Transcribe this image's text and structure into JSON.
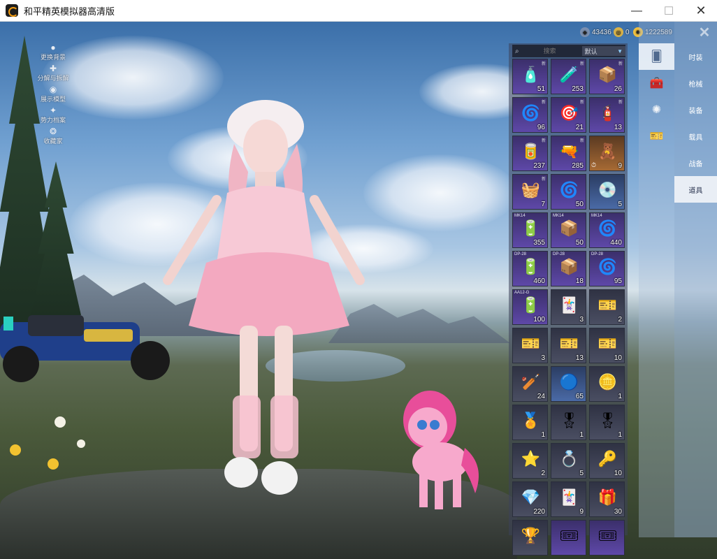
{
  "window": {
    "title": "和平精英模拟器高清版",
    "minimize": "—",
    "maximize": "☐",
    "close": "✕"
  },
  "quick_menu": [
    {
      "label": "更换背景",
      "icon": "person-icon"
    },
    {
      "label": "分解与拆解",
      "icon": "puzzle-icon"
    },
    {
      "label": "展示模型",
      "icon": "eye-icon"
    },
    {
      "label": "势力档案",
      "icon": "emblem-icon"
    },
    {
      "label": "收藏家",
      "icon": "badge-icon"
    }
  ],
  "currency": [
    {
      "value": "43436",
      "icon": "coin-icon",
      "color": "#7a8fb0"
    },
    {
      "value": "0",
      "icon": "token-icon",
      "color": "#d8b34a"
    },
    {
      "value": "1222589",
      "icon": "gold-icon",
      "color": "#f0c040"
    }
  ],
  "inventory": {
    "search_placeholder": "搜索",
    "sort_label": "默认",
    "items": [
      {
        "count": "51",
        "style": "purple",
        "glyph": "🧴",
        "new": "新"
      },
      {
        "count": "253",
        "style": "purple",
        "glyph": "🧪",
        "new": "新"
      },
      {
        "count": "26",
        "style": "purple",
        "glyph": "📦",
        "new": "新"
      },
      {
        "count": "96",
        "style": "purple",
        "glyph": "🌀",
        "new": "新"
      },
      {
        "count": "21",
        "style": "purple",
        "glyph": "🎯",
        "new": "新"
      },
      {
        "count": "13",
        "style": "purple",
        "glyph": "🧯",
        "new": "新"
      },
      {
        "count": "237",
        "style": "purple",
        "glyph": "🥫",
        "new": "新"
      },
      {
        "count": "285",
        "style": "purple",
        "glyph": "🔫",
        "new": "新"
      },
      {
        "count": "9",
        "style": "orange",
        "glyph": "🧸",
        "new": "",
        "timer": "⏱"
      },
      {
        "count": "7",
        "style": "purple",
        "glyph": "🧺",
        "new": "新"
      },
      {
        "count": "50",
        "style": "purple",
        "glyph": "🌀",
        "new": ""
      },
      {
        "count": "5",
        "style": "blue",
        "glyph": "💿",
        "new": ""
      },
      {
        "count": "355",
        "style": "purple",
        "glyph": "🔋",
        "tag": "MK14"
      },
      {
        "count": "50",
        "style": "purple",
        "glyph": "📦",
        "tag": "MK14"
      },
      {
        "count": "440",
        "style": "purple",
        "glyph": "🌀",
        "tag": "MK14"
      },
      {
        "count": "460",
        "style": "purple",
        "glyph": "🔋",
        "tag": "DP-28"
      },
      {
        "count": "18",
        "style": "purple",
        "glyph": "📦",
        "tag": "DP-28"
      },
      {
        "count": "95",
        "style": "purple",
        "glyph": "🌀",
        "tag": "DP-28"
      },
      {
        "count": "100",
        "style": "purple",
        "glyph": "🔋",
        "tag": "AA12-G"
      },
      {
        "count": "3",
        "style": "dark",
        "glyph": "🃏",
        "new": ""
      },
      {
        "count": "2",
        "style": "dark",
        "glyph": "🎫",
        "new": ""
      },
      {
        "count": "3",
        "style": "dark",
        "glyph": "🎫",
        "new": ""
      },
      {
        "count": "13",
        "style": "dark",
        "glyph": "🎫",
        "new": ""
      },
      {
        "count": "10",
        "style": "dark",
        "glyph": "🎫",
        "new": ""
      },
      {
        "count": "24",
        "style": "dark",
        "glyph": "🏏",
        "new": ""
      },
      {
        "count": "65",
        "style": "blue",
        "glyph": "🔵",
        "new": ""
      },
      {
        "count": "1",
        "style": "dark",
        "glyph": "🪙",
        "new": ""
      },
      {
        "count": "1",
        "style": "dark",
        "glyph": "🏅",
        "new": ""
      },
      {
        "count": "1",
        "style": "dark",
        "glyph": "🎖",
        "new": ""
      },
      {
        "count": "1",
        "style": "dark",
        "glyph": "🎖",
        "new": ""
      },
      {
        "count": "2",
        "style": "dark",
        "glyph": "⭐",
        "new": ""
      },
      {
        "count": "5",
        "style": "dark",
        "glyph": "💍",
        "new": ""
      },
      {
        "count": "10",
        "style": "dark",
        "glyph": "🔑",
        "new": ""
      },
      {
        "count": "220",
        "style": "dark",
        "glyph": "💎",
        "new": ""
      },
      {
        "count": "9",
        "style": "dark",
        "glyph": "🃏",
        "new": ""
      },
      {
        "count": "30",
        "style": "dark",
        "glyph": "🎁",
        "new": ""
      },
      {
        "count": "",
        "style": "dark",
        "glyph": "🏆",
        "new": ""
      },
      {
        "count": "",
        "style": "purple",
        "glyph": "🎟",
        "new": ""
      },
      {
        "count": "",
        "style": "purple",
        "glyph": "🎟",
        "new": ""
      }
    ]
  },
  "categories": {
    "icons": [
      {
        "icon": "card-icon",
        "glyph": "🂠",
        "active": true
      },
      {
        "icon": "toolbox-icon",
        "glyph": "🧰",
        "active": false
      },
      {
        "icon": "sparkle-icon",
        "glyph": "✺",
        "active": false
      },
      {
        "icon": "ticket-icon",
        "glyph": "🎫",
        "active": false
      }
    ],
    "tabs": [
      {
        "label": "时装",
        "active": false
      },
      {
        "label": "枪械",
        "active": false
      },
      {
        "label": "装备",
        "active": false
      },
      {
        "label": "载具",
        "active": false
      },
      {
        "label": "战备",
        "active": false
      },
      {
        "label": "道具",
        "active": true
      }
    ]
  },
  "game_close": "✕"
}
